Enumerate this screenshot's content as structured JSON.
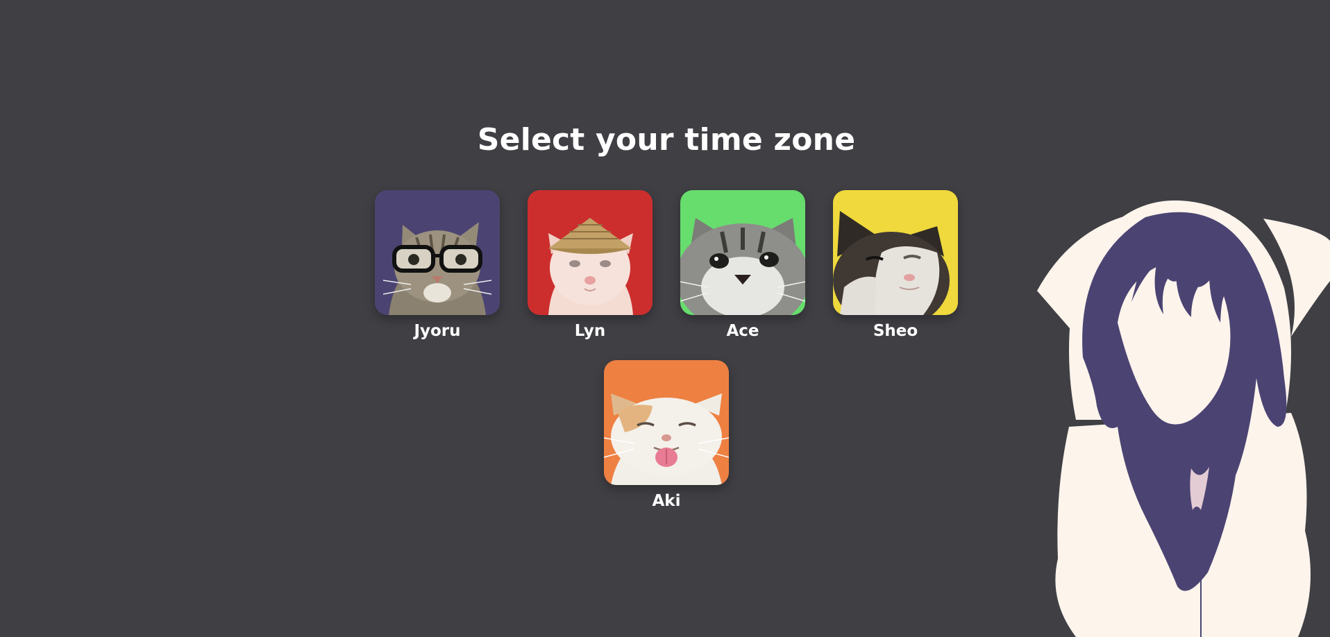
{
  "page": {
    "title": "Select your time zone",
    "background_color": "#3f3f44"
  },
  "zones": [
    {
      "name": "Jyoru",
      "tile_color": "#4b4472",
      "icon": "cat-with-glasses-icon"
    },
    {
      "name": "Lyn",
      "tile_color": "#cc2e2e",
      "icon": "cat-with-straw-hat-icon"
    },
    {
      "name": "Ace",
      "tile_color": "#67dd6e",
      "icon": "tabby-cat-closeup-icon"
    },
    {
      "name": "Sheo",
      "tile_color": "#efd93c",
      "icon": "black-white-cat-icon"
    },
    {
      "name": "Aki",
      "tile_color": "#ee8042",
      "icon": "cat-tongue-out-icon"
    }
  ],
  "decoration": {
    "icon": "hooded-girl-silhouette-icon",
    "hair_color": "#4b4472",
    "hood_color": "#fdf4ec"
  }
}
